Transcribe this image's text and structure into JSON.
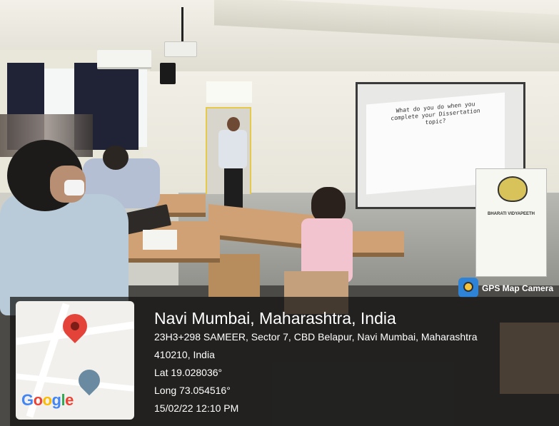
{
  "slide": {
    "lines": [
      "What do you do when you",
      "complete your Dissertation",
      "topic?"
    ]
  },
  "banner": {
    "title": "BHARATI VIDYAPEETH"
  },
  "camera_badge": {
    "label": "GPS Map Camera",
    "icon": "camera-icon"
  },
  "location": {
    "title": "Navi Mumbai, Maharashtra, India",
    "address_line1": "23H3+298 SAMEER, Sector 7, CBD Belapur, Navi Mumbai, Maharashtra",
    "address_line2": "410210, India",
    "lat": "Lat 19.028036°",
    "long": "Long 73.054516°",
    "datetime": "15/02/22 12:10 PM"
  },
  "map": {
    "logo_letters": [
      "G",
      "o",
      "o",
      "g",
      "l",
      "e"
    ],
    "pin_icon": "location-pin-icon",
    "school_icon": "school-marker-icon"
  }
}
